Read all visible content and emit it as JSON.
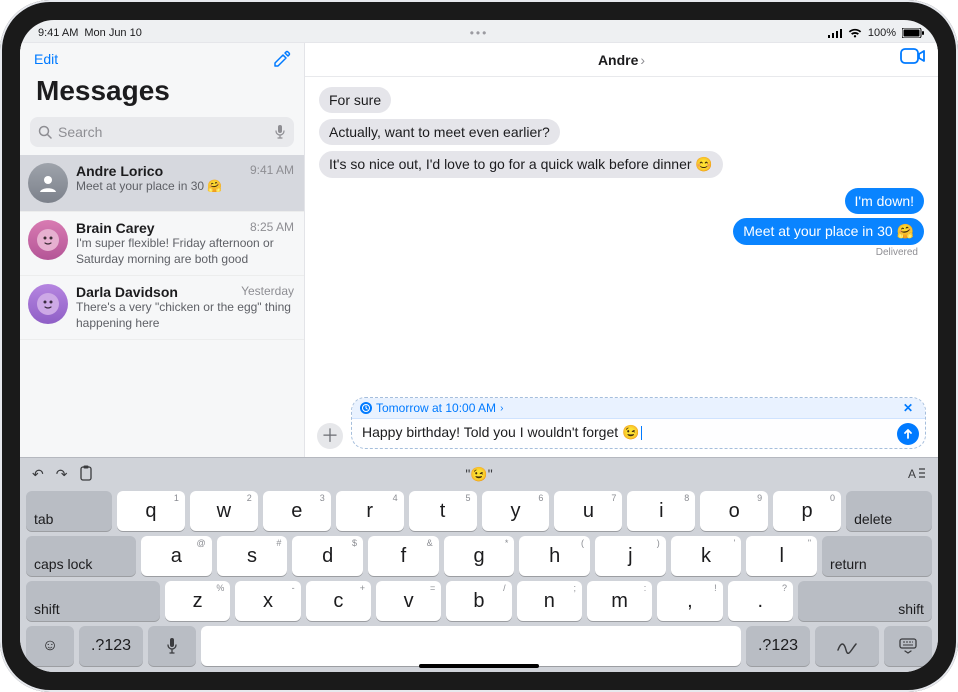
{
  "status": {
    "time": "9:41 AM",
    "date": "Mon Jun 10",
    "signal_pct": "100%",
    "dots": "•••"
  },
  "sidebar": {
    "edit": "Edit",
    "title": "Messages",
    "search_placeholder": "Search",
    "conversations": [
      {
        "name": "Andre Lorico",
        "time": "9:41 AM",
        "preview": "Meet at your place in 30 🤗"
      },
      {
        "name": "Brain Carey",
        "time": "8:25 AM",
        "preview": "I'm super flexible! Friday afternoon or Saturday morning are both good"
      },
      {
        "name": "Darla Davidson",
        "time": "Yesterday",
        "preview": "There's a very \"chicken or the egg\" thing happening here"
      }
    ]
  },
  "header": {
    "title": "Andre"
  },
  "thread": {
    "incoming": [
      "For sure",
      "Actually, want to meet even earlier?",
      "It's so nice out, I'd love to go for a quick walk before dinner 😊"
    ],
    "outgoing": [
      "I'm down!",
      "Meet at your place in 30 🤗"
    ],
    "delivered": "Delivered"
  },
  "compose": {
    "sched_time": "Tomorrow at 10:00 AM",
    "text": "Happy birthday! Told you I wouldn't forget 😉"
  },
  "keyboard": {
    "suggestion": "\"😉\"",
    "row1_sub": [
      "1",
      "2",
      "3",
      "4",
      "5",
      "6",
      "7",
      "8",
      "9",
      "0"
    ],
    "row1_main": [
      "q",
      "w",
      "e",
      "r",
      "t",
      "y",
      "u",
      "i",
      "o",
      "p"
    ],
    "row2_sub": [
      "@",
      "#",
      "$",
      "&",
      "*",
      "(",
      ")",
      "'",
      "\""
    ],
    "row2_main": [
      "a",
      "s",
      "d",
      "f",
      "g",
      "h",
      "j",
      "k",
      "l"
    ],
    "row3_sub": [
      "%",
      "-",
      "+",
      "=",
      "/",
      ";",
      ":",
      "!",
      "?"
    ],
    "row3_main": [
      "z",
      "x",
      "c",
      "v",
      "b",
      "n",
      "m",
      ",",
      "."
    ],
    "tab": "tab",
    "delete": "delete",
    "caps": "caps lock",
    "return": "return",
    "shift": "shift",
    "num": ".?123"
  }
}
